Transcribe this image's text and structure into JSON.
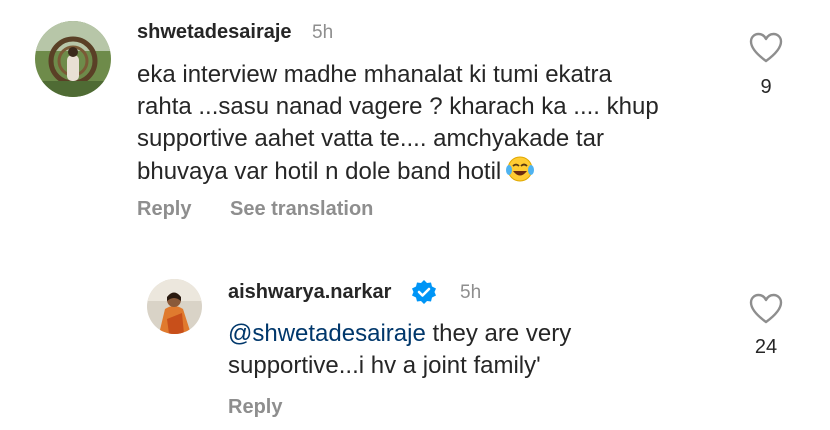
{
  "comment": {
    "username": "shwetadesairaje",
    "time": "5h",
    "lines": [
      "eka interview madhe mhanalat  ki tumi ekatra",
      "rahta ...sasu nanad vagere ? kharach ka .... khup",
      "supportive aahet vatta te.... amchyakade tar",
      "bhuvaya var hotil n dole band hotil"
    ],
    "emoji": "face-with-tears-of-joy",
    "likes": "9",
    "reply_label": "Reply",
    "translate_label": "See translation"
  },
  "reply": {
    "username": "aishwarya.narkar",
    "verified": true,
    "time": "5h",
    "mention": "@shwetadesairaje",
    "line1_rest": " they are very",
    "line2": "supportive...i hv a joint family'",
    "likes": "24",
    "reply_label": "Reply"
  },
  "colors": {
    "verified_badge": "#0095f6",
    "mention": "#00376b",
    "secondary_text": "#8e8e8e"
  }
}
